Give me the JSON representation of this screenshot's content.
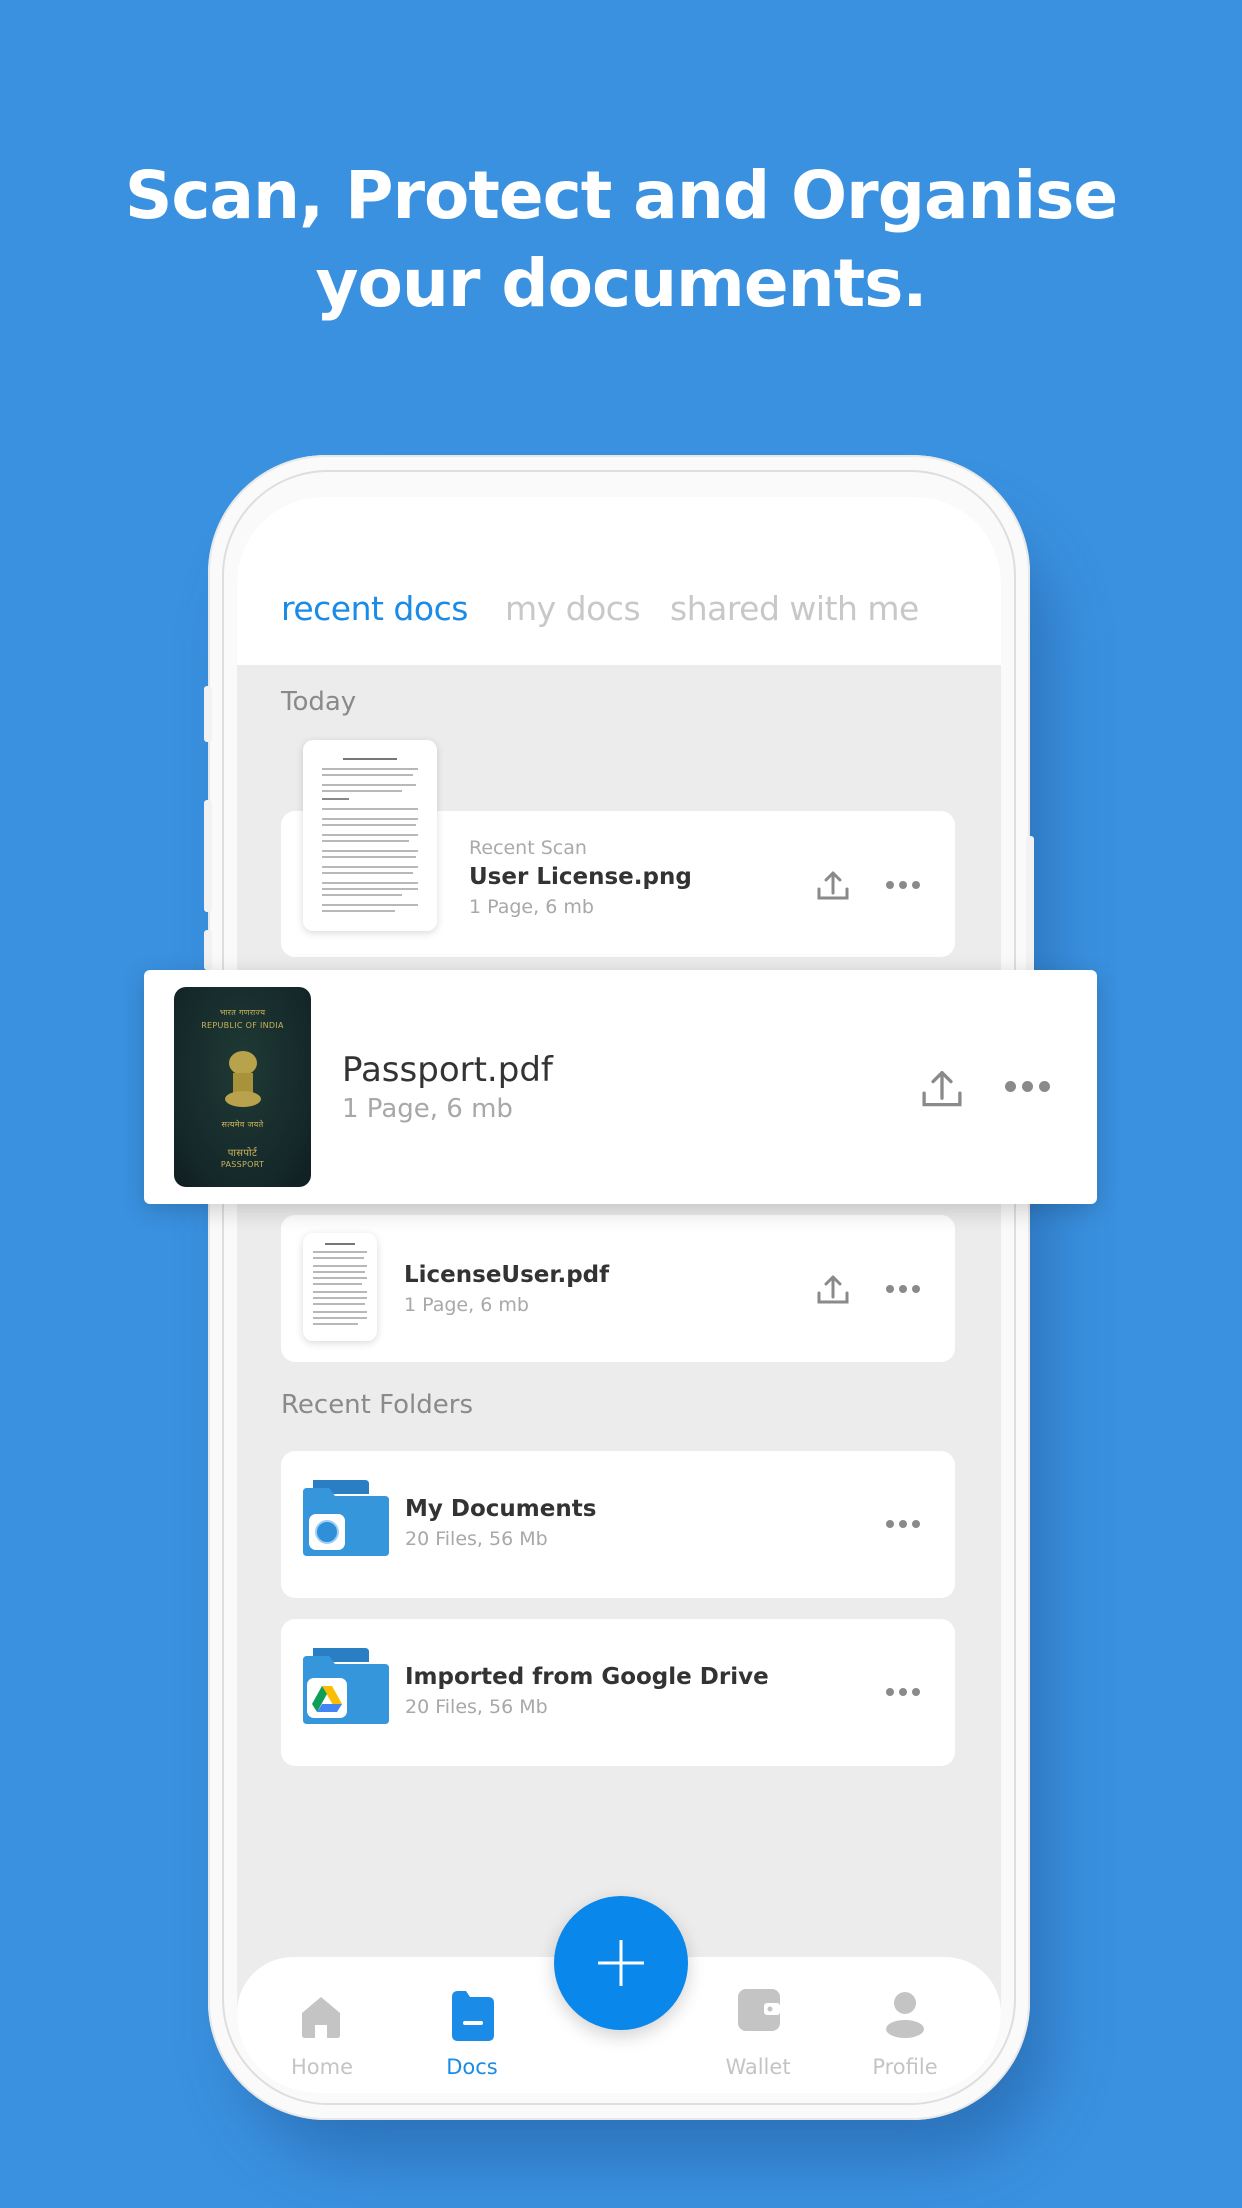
{
  "headline": {
    "line1": "Scan, Protect and Organise",
    "line2": "your documents."
  },
  "colors": {
    "background": "#3a91e0",
    "accent": "#1a8be6",
    "fab": "#0a87ea",
    "inactive": "#c4c4c4"
  },
  "tabs": [
    {
      "label": "recent docs",
      "active": true
    },
    {
      "label": "my docs",
      "active": false
    },
    {
      "label": "shared with me",
      "active": false
    }
  ],
  "sections": {
    "today": "Today",
    "recent_folders": "Recent Folders"
  },
  "files": [
    {
      "kicker": "Recent Scan",
      "name": "User License.png",
      "meta": "1 Page, 6 mb",
      "thumb": "document-thumbnail"
    },
    {
      "name": "Passport.pdf",
      "meta": "1 Page, 6 mb",
      "thumb": "passport-thumbnail",
      "passport_text": {
        "hindi_top": "भारत गणराज्य",
        "country": "REPUBLIC OF INDIA",
        "motto": "सत्यमेव जयते",
        "hindi_bottom": "पासपोर्ट",
        "label": "PASSPORT"
      }
    },
    {
      "name": "LicenseUser.pdf",
      "meta": "1 Page, 6 mb",
      "thumb": "document-thumbnail"
    }
  ],
  "folders": [
    {
      "name": "My Documents",
      "meta": "20 Files, 56 Mb",
      "badge": "app-logo-icon"
    },
    {
      "name": "Imported from Google Drive",
      "meta": "20 Files, 56 Mb",
      "badge": "google-drive-icon"
    }
  ],
  "icons": {
    "share": "upload-icon",
    "more": "more-horizontal-icon",
    "fab": "plus-icon"
  },
  "bottom_nav": [
    {
      "label": "Home",
      "icon": "home-icon",
      "active": false
    },
    {
      "label": "Docs",
      "icon": "docs-folder-icon",
      "active": true
    },
    {
      "label": "Wallet",
      "icon": "wallet-icon",
      "active": false
    },
    {
      "label": "Profile",
      "icon": "profile-icon",
      "active": false
    }
  ]
}
